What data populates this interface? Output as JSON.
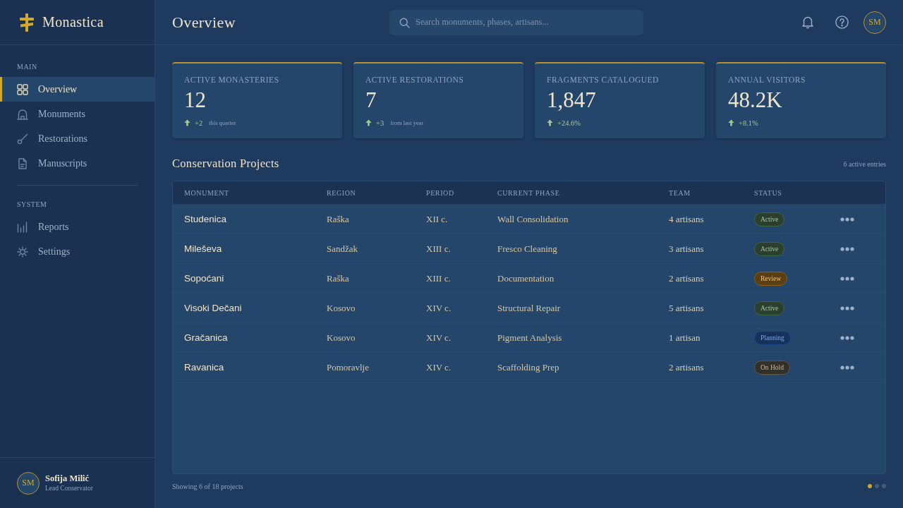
{
  "sidebar": {
    "brand": "Monastica",
    "sections": [
      {
        "title": "MAIN",
        "items": [
          {
            "label": "Overview",
            "selected": true
          },
          {
            "label": "Monuments",
            "selected": false
          },
          {
            "label": "Restorations",
            "selected": false
          },
          {
            "label": "Manuscripts",
            "selected": false
          }
        ]
      },
      {
        "title": "SYSTEM",
        "items": [
          {
            "label": "Reports",
            "selected": false
          },
          {
            "label": "Settings",
            "selected": false
          }
        ]
      }
    ],
    "user": {
      "initials": "SM",
      "name": "Sofija Milić",
      "role": "Lead Conservator"
    }
  },
  "header": {
    "title": "Overview",
    "search": {
      "placeholder": "Search monuments, phases, artisans..."
    },
    "avatar": "SM"
  },
  "stats": [
    {
      "label": "ACTIVE MONASTERIES",
      "value": "12",
      "delta": "+2",
      "note": "this quarter"
    },
    {
      "label": "ACTIVE RESTORATIONS",
      "value": "7",
      "delta": "+3",
      "note": "from last year"
    },
    {
      "label": "FRAGMENTS CATALOGUED",
      "value": "1,847",
      "delta": "+24.6%"
    },
    {
      "label": "ANNUAL VISITORS",
      "value": "48.2K",
      "delta": "+8.1%"
    }
  ],
  "projects": {
    "title": "Conservation Projects",
    "count": "6 active entries",
    "table": {
      "columns": [
        "MONUMENT",
        "REGION",
        "PERIOD",
        "CURRENT PHASE",
        "TEAM",
        "STATUS"
      ],
      "rows": [
        {
          "monument": "Studenica",
          "region": "Raška",
          "period": "XII c.",
          "phase": "Wall Consolidation",
          "team": "4 artisans",
          "status": {
            "label": "Active",
            "color": "#2c3f2e"
          }
        },
        {
          "monument": "Mileševa",
          "region": "Sandžak",
          "period": "XIII c.",
          "phase": "Fresco Cleaning",
          "team": "3 artisans",
          "status": {
            "label": "Active",
            "color": "#2c3f2e"
          }
        },
        {
          "monument": "Sopoćani",
          "region": "Raška",
          "period": "XIII c.",
          "phase": "Documentation",
          "team": "2 artisans",
          "status": {
            "label": "Review",
            "color": "#5a3f14"
          }
        },
        {
          "monument": "Visoki Dečani",
          "region": "Kosovo",
          "period": "XIV c.",
          "phase": "Structural Repair",
          "team": "5 artisans",
          "status": {
            "label": "Active",
            "color": "#2c3f2e"
          }
        },
        {
          "monument": "Gračanica",
          "region": "Kosovo",
          "period": "XIV c.",
          "phase": "Pigment Analysis",
          "team": "1 artisan",
          "status": {
            "label": "Planning",
            "color": "#16325a"
          }
        },
        {
          "monument": "Ravanica",
          "region": "Pomoravlje",
          "period": "XIV c.",
          "phase": "Scaffolding Prep",
          "team": "2 artisans",
          "status": {
            "label": "On Hold",
            "color": "#33302a"
          }
        }
      ]
    },
    "footer": "Showing 6 of 18 projects",
    "pages": [
      {
        "selected": true
      },
      {
        "selected": false
      },
      {
        "selected": false
      }
    ]
  }
}
